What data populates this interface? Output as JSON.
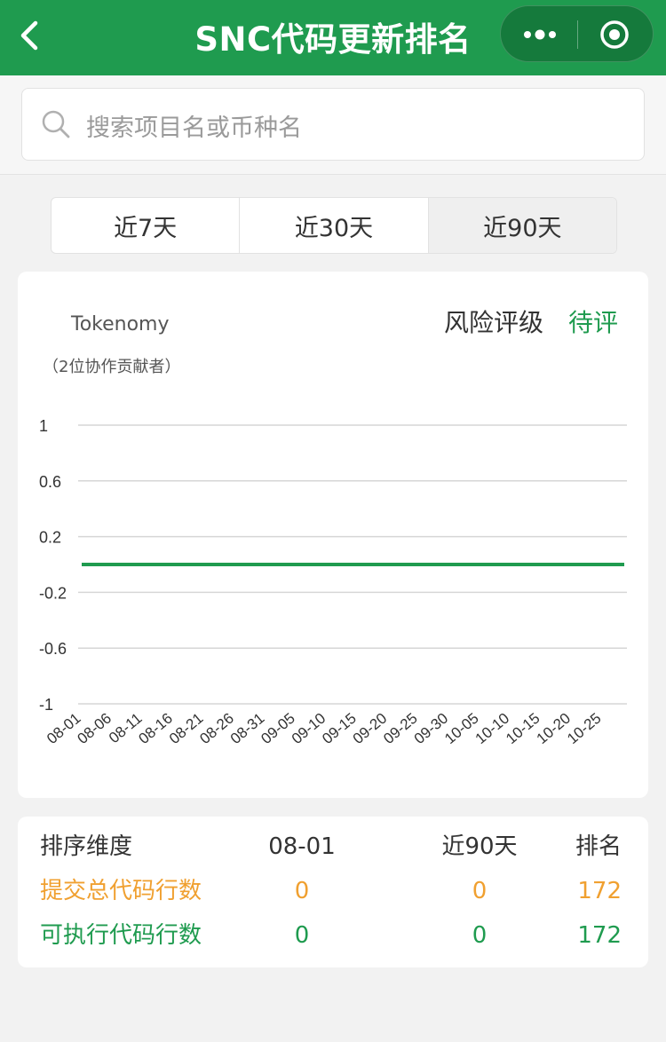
{
  "nav": {
    "title": "SNC代码更新排名",
    "back_icon": "chevron-left-icon",
    "more_icon": "more-dots-icon",
    "close_icon": "target-circle-icon"
  },
  "search": {
    "placeholder": "搜索项目名或币种名",
    "icon": "search-icon"
  },
  "tabs": [
    {
      "label": "近7天"
    },
    {
      "label": "近30天"
    },
    {
      "label": "近90天",
      "selected": true
    }
  ],
  "project": {
    "name": "Tokenomy",
    "contributors": "（2位协作贡献者）",
    "risk_label": "风险评级",
    "risk_value": "待评"
  },
  "chart_data": {
    "type": "line",
    "title": "",
    "xlabel": "",
    "ylabel": "",
    "ylim": [
      -1,
      1
    ],
    "y_ticks": [
      "1",
      "0.6",
      "0.2",
      "-0.2",
      "-0.6",
      "-1"
    ],
    "y_tick_values": [
      1,
      0.6,
      0.2,
      -0.2,
      -0.6,
      -1
    ],
    "x_ticks": [
      "08-01",
      "08-06",
      "08-11",
      "08-16",
      "08-21",
      "08-26",
      "08-31",
      "09-05",
      "09-10",
      "09-15",
      "09-20",
      "09-25",
      "09-30",
      "10-05",
      "10-10",
      "10-15",
      "10-20",
      "10-25"
    ],
    "grid": true,
    "series": [
      {
        "color": "#1f9b4f",
        "x": [
          "08-01",
          "10-29"
        ],
        "values": [
          0,
          0
        ]
      }
    ]
  },
  "table": {
    "headers": [
      "排序维度",
      "08-01",
      "近90天",
      "排名"
    ],
    "rows": [
      {
        "name": "提交总代码行数",
        "d1": "0",
        "d90": "0",
        "rank": "172",
        "color": "#f0a030"
      },
      {
        "name": "可执行代码行数",
        "d1": "0",
        "d90": "0",
        "rank": "172",
        "color": "#1f9b4f"
      }
    ]
  },
  "colors": {
    "brand": "#1f9b4f",
    "accent_orange": "#f0a030"
  }
}
